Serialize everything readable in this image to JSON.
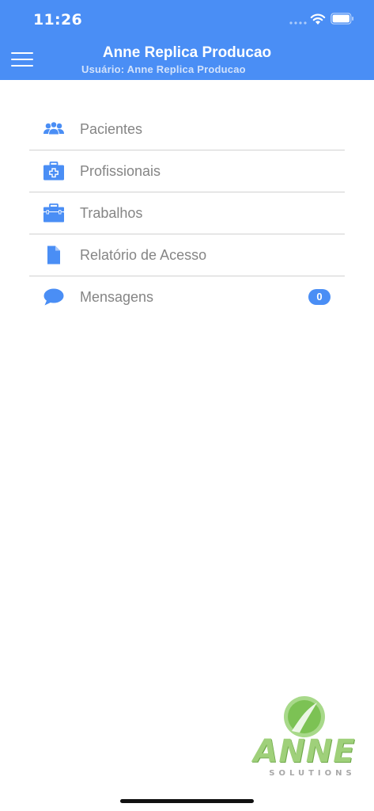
{
  "status_bar": {
    "time": "11:26"
  },
  "header": {
    "title": "Anne Replica Producao",
    "user_line": "Usuário: Anne Replica Producao",
    "menu_icon": "hamburger-icon"
  },
  "colors": {
    "accent": "#4a8ef5",
    "text_muted": "#858585",
    "divider": "#d1d1d1",
    "logo_green": "#9fd07a"
  },
  "menu": {
    "items": [
      {
        "label": "Pacientes",
        "icon": "users-icon"
      },
      {
        "label": "Profissionais",
        "icon": "medical-kit-icon"
      },
      {
        "label": "Trabalhos",
        "icon": "toolbox-icon"
      },
      {
        "label": "Relatório de Acesso",
        "icon": "document-icon"
      },
      {
        "label": "Mensagens",
        "icon": "chat-bubble-icon",
        "badge": "0"
      }
    ]
  },
  "logo": {
    "word": "ANNE",
    "sub": "SOLUTIONS"
  }
}
